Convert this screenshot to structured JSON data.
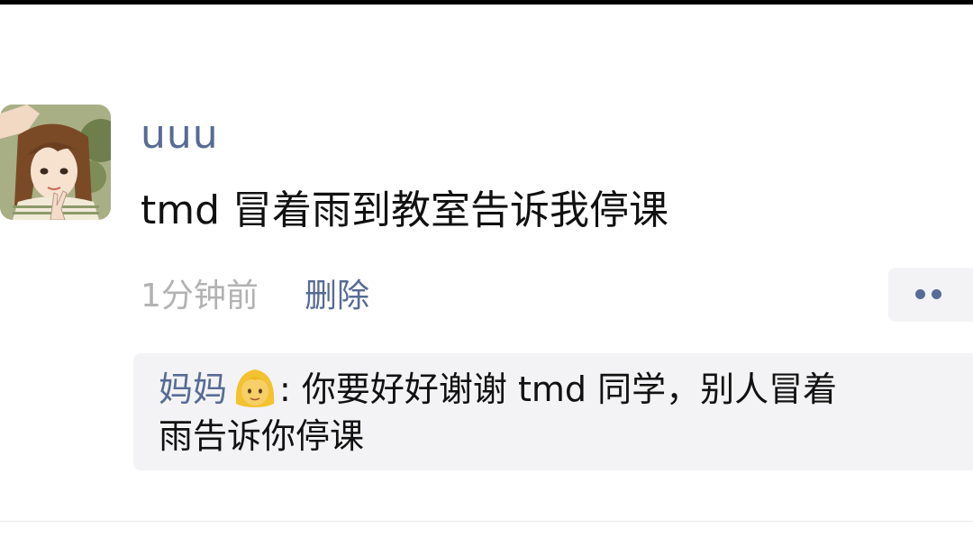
{
  "post": {
    "username": "uuu",
    "text": "tmd 冒着雨到教室告诉我停课",
    "timestamp": "1分钟前",
    "delete_label": "删除"
  },
  "comments": [
    {
      "author": "妈妈",
      "emoji": "woman-blonde-emoji",
      "separator": ": ",
      "text_line1": "你要好好谢谢 tmd 同学，别人冒着",
      "text_line2": "雨告诉你停课"
    }
  ],
  "colors": {
    "link": "#576b95",
    "text": "#111111",
    "meta": "#b2b2b2",
    "comment_bg": "#f3f3f5"
  },
  "icons": {
    "more": "more-dots-icon",
    "avatar": "anime-girl-avatar"
  }
}
